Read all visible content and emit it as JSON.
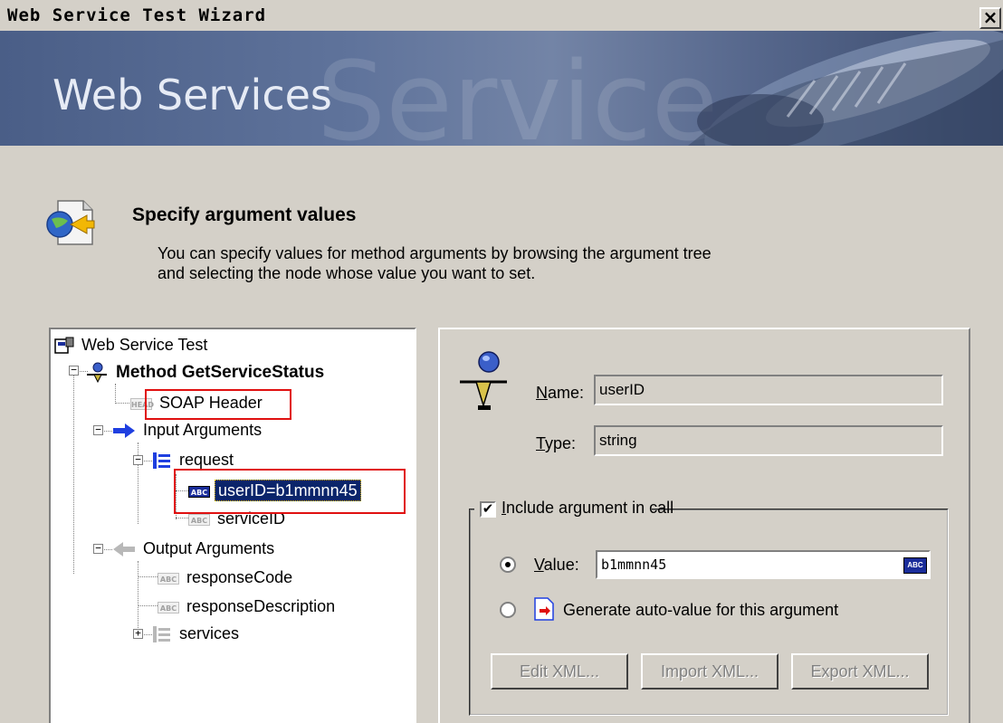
{
  "window": {
    "title": "Web Service Test Wizard",
    "close_label": "×"
  },
  "banner": {
    "title": "Web Services",
    "watermark": "Service"
  },
  "header": {
    "title": "Specify argument values",
    "description_line1": "You can specify values for method arguments by browsing the argument tree",
    "description_line2": "and selecting the node whose value you want to set."
  },
  "tree": {
    "root": "Web Service Test",
    "method": "Method GetServiceStatus",
    "soap_header": "SOAP Header",
    "input_arguments": "Input Arguments",
    "request": "request",
    "user_id": "userID=b1mmnn45",
    "service_id": "serviceID",
    "output_arguments": "Output Arguments",
    "response_code": "responseCode",
    "response_description": "responseDescription",
    "services": "services",
    "expander_minus": "−",
    "expander_plus": "+",
    "abc_badge": "ABC",
    "head_badge": "HEAD"
  },
  "details": {
    "name_label": "ame:",
    "name_label_key": "N",
    "name_value": "userID",
    "type_label": "ype:",
    "type_label_key": "T",
    "type_value": "string",
    "include_label": "nclude argument in call",
    "include_label_key": "I",
    "include_checked": "✔",
    "value_label": "alue:",
    "value_label_key": "V",
    "value_input": "b1mmnn45",
    "auto_value_label": "Generate auto-value for this argument",
    "edit_xml": "Edit XML...",
    "import_xml": "Import XML...",
    "export_xml": "Export XML..."
  },
  "colors": {
    "highlight_box": "#e01010",
    "selection": "#0a246a",
    "window_bg": "#d4d0c8"
  }
}
